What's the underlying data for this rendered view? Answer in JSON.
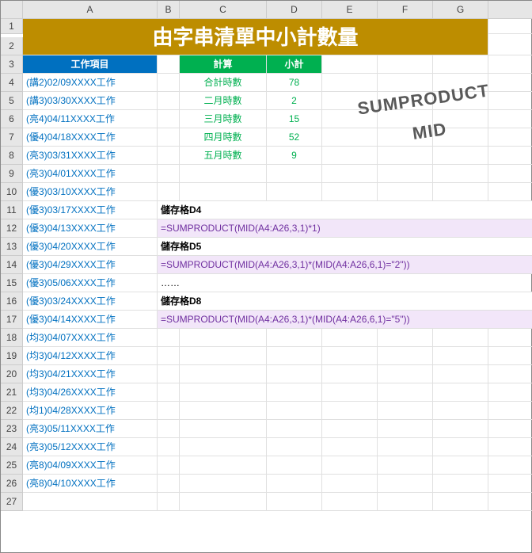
{
  "cols": [
    "A",
    "B",
    "C",
    "D",
    "E",
    "F",
    "G"
  ],
  "rows": [
    1,
    2,
    3,
    4,
    5,
    6,
    7,
    8,
    9,
    10,
    11,
    12,
    13,
    14,
    15,
    16,
    17,
    18,
    19,
    20,
    21,
    22,
    23,
    24,
    25,
    26,
    27
  ],
  "title": "由字串清單中小計數量",
  "headers": {
    "work": "工作項目",
    "calc": "計算",
    "sub": "小計"
  },
  "calc": [
    {
      "label": "合計時數",
      "val": "78"
    },
    {
      "label": "二月時數",
      "val": "2"
    },
    {
      "label": "三月時數",
      "val": "15"
    },
    {
      "label": "四月時數",
      "val": "52"
    },
    {
      "label": "五月時數",
      "val": "9"
    }
  ],
  "items": [
    "(講2)02/09XXXX工作",
    "(講3)03/30XXXX工作",
    "(亮4)04/11XXXX工作",
    "(優4)04/18XXXX工作",
    "(亮3)03/31XXXX工作",
    "(亮3)04/01XXXX工作",
    "(優3)03/10XXXX工作",
    "(優3)03/17XXXX工作",
    "(優3)04/13XXXX工作",
    "(優3)04/20XXXX工作",
    "(優3)04/29XXXX工作",
    "(優3)05/06XXXX工作",
    "(優3)03/24XXXX工作",
    "(優3)04/14XXXX工作",
    "(均3)04/07XXXX工作",
    "(均3)04/12XXXX工作",
    "(均3)04/21XXXX工作",
    "(均3)04/26XXXX工作",
    "(均1)04/28XXXX工作",
    "(亮3)05/11XXXX工作",
    "(亮3)05/12XXXX工作",
    "(亮8)04/09XXXX工作",
    "(亮8)04/10XXXX工作"
  ],
  "labels": {
    "d4": "儲存格D4",
    "d5": "儲存格D5",
    "d8": "儲存格D8",
    "dots": "……"
  },
  "formulas": {
    "f1": "=SUMPRODUCT(MID(A4:A26,3,1)*1)",
    "f2": "=SUMPRODUCT(MID(A4:A26,3,1)*(MID(A4:A26,6,1)=\"2\"))",
    "f3": "=SUMPRODUCT(MID(A4:A26,3,1)*(MID(A4:A26,6,1)=\"5\"))"
  },
  "annot": {
    "a1": "SUMPRODUCT",
    "a2": "MID"
  }
}
